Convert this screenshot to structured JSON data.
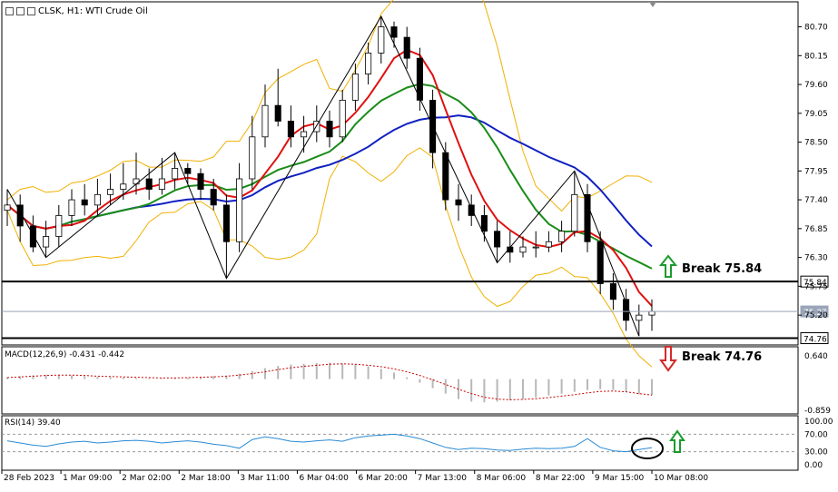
{
  "header": {
    "symbol": "CLSK, H1:",
    "instrument": "WTI Crude Oil",
    "icons": [
      "window-menu-icon",
      "chart-type-icon",
      "timeframe-icon"
    ]
  },
  "annotations": {
    "break_up": "Break 75.84",
    "break_down": "Break 74.76"
  },
  "colors": {
    "upper_arrow": "#1a9c2e",
    "lower_arrow": "#d42a2a",
    "ma_fast": "#e01010",
    "ma_mid": "#1a8c1a",
    "ma_slow": "#1020c0",
    "bollinger": "#f0b000",
    "macd_signal": "#cc0000",
    "rsi": "#2a8ad4"
  },
  "chart_data": [
    {
      "type": "line",
      "title": "CLSK, H1: WTI Crude Oil",
      "price_ticks": [
        "80.70",
        "80.15",
        "79.60",
        "79.05",
        "78.50",
        "77.95",
        "77.40",
        "76.85",
        "76.30",
        "75.75",
        "75.20"
      ],
      "ylim": [
        74.7,
        80.9
      ],
      "x_ticks": [
        "28 Feb 2023",
        "1 Mar 09:00",
        "2 Mar 02:00",
        "2 Mar 18:00",
        "3 Mar 11:00",
        "6 Mar 04:00",
        "6 Mar 20:00",
        "7 Mar 13:00",
        "8 Mar 06:00",
        "8 Mar 22:00",
        "9 Mar 15:00",
        "10 Mar 08:00"
      ],
      "levels": [
        {
          "label": "75.84",
          "value": 75.84
        },
        {
          "label": "74.76",
          "value": 74.76
        }
      ],
      "current_price": {
        "label": "75.27",
        "value": 75.27
      },
      "series": [
        {
          "values": [
            77.2,
            77.3,
            76.9,
            76.5,
            76.7,
            77.1,
            77.4,
            77.3,
            77.5,
            77.6,
            77.7,
            77.8,
            77.6,
            77.8,
            78.0,
            77.9,
            77.6,
            77.3,
            76.6,
            77.8,
            78.6,
            79.2,
            78.9,
            78.6,
            78.7,
            78.9,
            78.6,
            79.3,
            79.8,
            80.2,
            80.7,
            80.5,
            80.1,
            79.3,
            78.3,
            77.4,
            77.3,
            77.1,
            76.8,
            76.5,
            76.4,
            76.5,
            76.5,
            76.6,
            76.8,
            77.5,
            76.6,
            75.8,
            75.5,
            75.1,
            75.2
          ]
        }
      ],
      "ohlc": [
        {
          "o": 77.2,
          "h": 77.6,
          "l": 76.9,
          "c": 77.3
        },
        {
          "o": 77.3,
          "h": 77.5,
          "l": 76.6,
          "c": 76.9
        },
        {
          "o": 76.9,
          "h": 77.1,
          "l": 76.4,
          "c": 76.5
        },
        {
          "o": 76.5,
          "h": 77.0,
          "l": 76.3,
          "c": 76.7
        },
        {
          "o": 76.7,
          "h": 77.3,
          "l": 76.5,
          "c": 77.1
        },
        {
          "o": 77.1,
          "h": 77.6,
          "l": 76.9,
          "c": 77.4
        },
        {
          "o": 77.4,
          "h": 77.7,
          "l": 77.1,
          "c": 77.3
        },
        {
          "o": 77.3,
          "h": 77.8,
          "l": 77.1,
          "c": 77.5
        },
        {
          "o": 77.5,
          "h": 77.9,
          "l": 77.3,
          "c": 77.6
        },
        {
          "o": 77.6,
          "h": 78.1,
          "l": 77.4,
          "c": 77.7
        },
        {
          "o": 77.7,
          "h": 78.3,
          "l": 77.5,
          "c": 77.8
        },
        {
          "o": 77.8,
          "h": 78.0,
          "l": 77.4,
          "c": 77.6
        },
        {
          "o": 77.6,
          "h": 78.2,
          "l": 77.5,
          "c": 77.8
        },
        {
          "o": 77.8,
          "h": 78.3,
          "l": 77.6,
          "c": 78.0
        },
        {
          "o": 78.0,
          "h": 78.1,
          "l": 77.7,
          "c": 77.9
        },
        {
          "o": 77.9,
          "h": 78.0,
          "l": 77.4,
          "c": 77.6
        },
        {
          "o": 77.6,
          "h": 77.8,
          "l": 77.2,
          "c": 77.3
        },
        {
          "o": 77.3,
          "h": 77.5,
          "l": 75.9,
          "c": 76.6
        },
        {
          "o": 76.6,
          "h": 78.1,
          "l": 76.4,
          "c": 77.8
        },
        {
          "o": 77.8,
          "h": 79.0,
          "l": 77.6,
          "c": 78.6
        },
        {
          "o": 78.6,
          "h": 79.6,
          "l": 78.4,
          "c": 79.2
        },
        {
          "o": 79.2,
          "h": 79.9,
          "l": 78.8,
          "c": 78.9
        },
        {
          "o": 78.9,
          "h": 79.2,
          "l": 78.4,
          "c": 78.6
        },
        {
          "o": 78.6,
          "h": 79.0,
          "l": 78.3,
          "c": 78.7
        },
        {
          "o": 78.7,
          "h": 79.2,
          "l": 78.5,
          "c": 78.9
        },
        {
          "o": 78.9,
          "h": 79.1,
          "l": 78.4,
          "c": 78.6
        },
        {
          "o": 78.6,
          "h": 79.5,
          "l": 78.5,
          "c": 79.3
        },
        {
          "o": 79.3,
          "h": 80.0,
          "l": 79.1,
          "c": 79.8
        },
        {
          "o": 79.8,
          "h": 80.4,
          "l": 79.6,
          "c": 80.2
        },
        {
          "o": 80.2,
          "h": 80.9,
          "l": 80.0,
          "c": 80.7
        },
        {
          "o": 80.7,
          "h": 80.8,
          "l": 80.3,
          "c": 80.5
        },
        {
          "o": 80.5,
          "h": 80.7,
          "l": 79.9,
          "c": 80.1
        },
        {
          "o": 80.1,
          "h": 80.3,
          "l": 79.1,
          "c": 79.3
        },
        {
          "o": 79.3,
          "h": 79.5,
          "l": 78.0,
          "c": 78.3
        },
        {
          "o": 78.3,
          "h": 78.5,
          "l": 77.2,
          "c": 77.4
        },
        {
          "o": 77.4,
          "h": 77.7,
          "l": 77.0,
          "c": 77.3
        },
        {
          "o": 77.3,
          "h": 77.5,
          "l": 76.9,
          "c": 77.1
        },
        {
          "o": 77.1,
          "h": 77.3,
          "l": 76.6,
          "c": 76.8
        },
        {
          "o": 76.8,
          "h": 77.0,
          "l": 76.2,
          "c": 76.5
        },
        {
          "o": 76.5,
          "h": 76.8,
          "l": 76.2,
          "c": 76.4
        },
        {
          "o": 76.4,
          "h": 76.7,
          "l": 76.3,
          "c": 76.5
        },
        {
          "o": 76.5,
          "h": 76.8,
          "l": 76.3,
          "c": 76.5
        },
        {
          "o": 76.5,
          "h": 76.8,
          "l": 76.4,
          "c": 76.6
        },
        {
          "o": 76.6,
          "h": 77.0,
          "l": 76.4,
          "c": 76.8
        },
        {
          "o": 76.8,
          "h": 77.95,
          "l": 76.7,
          "c": 77.5
        },
        {
          "o": 77.5,
          "h": 77.7,
          "l": 76.4,
          "c": 76.6
        },
        {
          "o": 76.6,
          "h": 76.8,
          "l": 75.6,
          "c": 75.8
        },
        {
          "o": 75.8,
          "h": 76.0,
          "l": 75.3,
          "c": 75.5
        },
        {
          "o": 75.5,
          "h": 75.7,
          "l": 74.9,
          "c": 75.1
        },
        {
          "o": 75.1,
          "h": 75.4,
          "l": 74.8,
          "c": 75.2
        },
        {
          "o": 75.2,
          "h": 75.5,
          "l": 74.9,
          "c": 75.27
        }
      ]
    },
    {
      "type": "bar",
      "title": "MACD(12,26,9) -0.431 -0.442",
      "y_ticks": [
        "0.640",
        "-0.859"
      ],
      "ylim": [
        -0.859,
        0.64
      ],
      "series": [
        {
          "values": [
            0.05,
            0.08,
            0.1,
            0.12,
            0.12,
            0.1,
            0.08,
            0.06,
            0.05,
            0.04,
            0.03,
            0.02,
            0.02,
            0.03,
            0.04,
            0.06,
            0.08,
            0.1,
            0.15,
            0.22,
            0.3,
            0.36,
            0.4,
            0.42,
            0.44,
            0.45,
            0.43,
            0.4,
            0.35,
            0.28,
            0.18,
            0.05,
            -0.1,
            -0.25,
            -0.4,
            -0.55,
            -0.62,
            -0.64,
            -0.62,
            -0.58,
            -0.55,
            -0.5,
            -0.45,
            -0.4,
            -0.35,
            -0.3,
            -0.28,
            -0.3,
            -0.36,
            -0.42,
            -0.44
          ]
        },
        {
          "values": [
            0.04,
            0.06,
            0.08,
            0.1,
            0.11,
            0.11,
            0.1,
            0.08,
            0.07,
            0.06,
            0.05,
            0.04,
            0.03,
            0.03,
            0.04,
            0.05,
            0.06,
            0.08,
            0.11,
            0.15,
            0.2,
            0.26,
            0.31,
            0.35,
            0.38,
            0.41,
            0.42,
            0.41,
            0.38,
            0.34,
            0.28,
            0.2,
            0.1,
            -0.02,
            -0.15,
            -0.28,
            -0.4,
            -0.5,
            -0.55,
            -0.57,
            -0.56,
            -0.54,
            -0.51,
            -0.47,
            -0.43,
            -0.38,
            -0.34,
            -0.33,
            -0.35,
            -0.4,
            -0.44
          ]
        }
      ]
    },
    {
      "type": "line",
      "title": "RSI(14) 39.40",
      "y_ticks": [
        "100.00",
        "70.00",
        "30.00",
        "0.00"
      ],
      "ylim": [
        0,
        100
      ],
      "series": [
        {
          "values": [
            55,
            50,
            45,
            42,
            48,
            52,
            54,
            50,
            52,
            55,
            56,
            54,
            50,
            53,
            55,
            52,
            47,
            44,
            38,
            58,
            64,
            60,
            54,
            52,
            55,
            57,
            54,
            62,
            66,
            68,
            70,
            66,
            60,
            50,
            40,
            35,
            38,
            37,
            34,
            33,
            36,
            38,
            37,
            38,
            42,
            60,
            40,
            32,
            30,
            35,
            39.4
          ]
        }
      ]
    }
  ]
}
